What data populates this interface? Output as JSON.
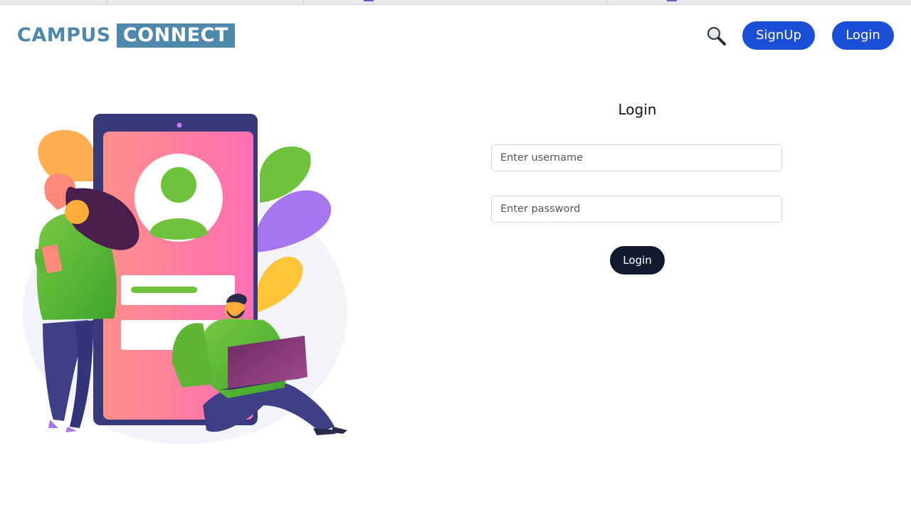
{
  "header": {
    "logo_part1": "CAMPUS",
    "logo_part2": "CONNECT",
    "search_icon": "magnifier-icon",
    "signup_label": "SignUp",
    "login_label": "Login"
  },
  "login_form": {
    "title": "Login",
    "username_placeholder": "Enter username",
    "username_value": "",
    "password_placeholder": "Enter password",
    "password_value": "",
    "submit_label": "Login"
  },
  "colors": {
    "brand": "#4e88ad",
    "header_button": "#1b4fd6",
    "submit_button": "#111a2e"
  }
}
